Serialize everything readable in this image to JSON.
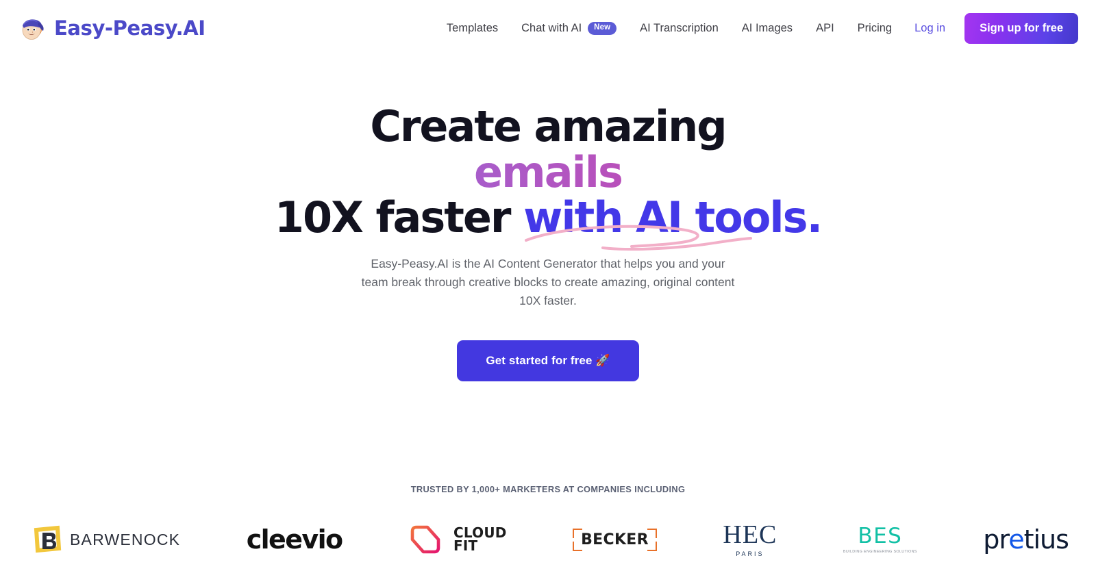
{
  "brand": {
    "name": "Easy-Peasy.AI",
    "avatar_icon": "avatar-face-icon"
  },
  "nav": {
    "links": [
      {
        "label": "Templates",
        "badge": null
      },
      {
        "label": "Chat with AI",
        "badge": "New"
      },
      {
        "label": "AI Transcription",
        "badge": null
      },
      {
        "label": "AI Images",
        "badge": null
      },
      {
        "label": "API",
        "badge": null
      },
      {
        "label": "Pricing",
        "badge": null
      }
    ],
    "login_label": "Log in",
    "signup_label": "Sign up for free"
  },
  "hero": {
    "headline_line1": "Create amazing",
    "headline_line2": "emails",
    "headline_line3_plain": "10X faster ",
    "headline_line3_accent": "with AI tools.",
    "subtext": "Easy-Peasy.AI is the AI Content Generator that helps you and your team break through creative blocks to create amazing, original content 10X faster.",
    "cta_label": "Get started for free 🚀"
  },
  "social_proof": {
    "heading": "TRUSTED BY 1,000+ MARKETERS AT COMPANIES INCLUDING",
    "logos": [
      {
        "id": "barwenock",
        "name": "BARWENOCK"
      },
      {
        "id": "cleevio",
        "name": "cleevio"
      },
      {
        "id": "cloudfit",
        "name": "CLOUD",
        "name2": "FIT"
      },
      {
        "id": "becker",
        "name": "BECKER"
      },
      {
        "id": "hec",
        "name": "HEC",
        "sub": "PARIS"
      },
      {
        "id": "bes",
        "name": "BES",
        "sub": "BUILDING ENGINEERING SOLUTIONS"
      },
      {
        "id": "pretius",
        "name": "pretius"
      }
    ]
  },
  "colors": {
    "brand_purple": "#4b49c8",
    "cta_indigo": "#4338e0",
    "badge_indigo": "#5b5bd6",
    "accent_blue": "#4338e8",
    "swoosh_pink": "#f0a8c4",
    "gradient_emails_start": "#7d7fe8",
    "gradient_emails_end": "#e22e6b",
    "signup_gradient_start": "#a435f0",
    "signup_gradient_end": "#4338ca"
  }
}
